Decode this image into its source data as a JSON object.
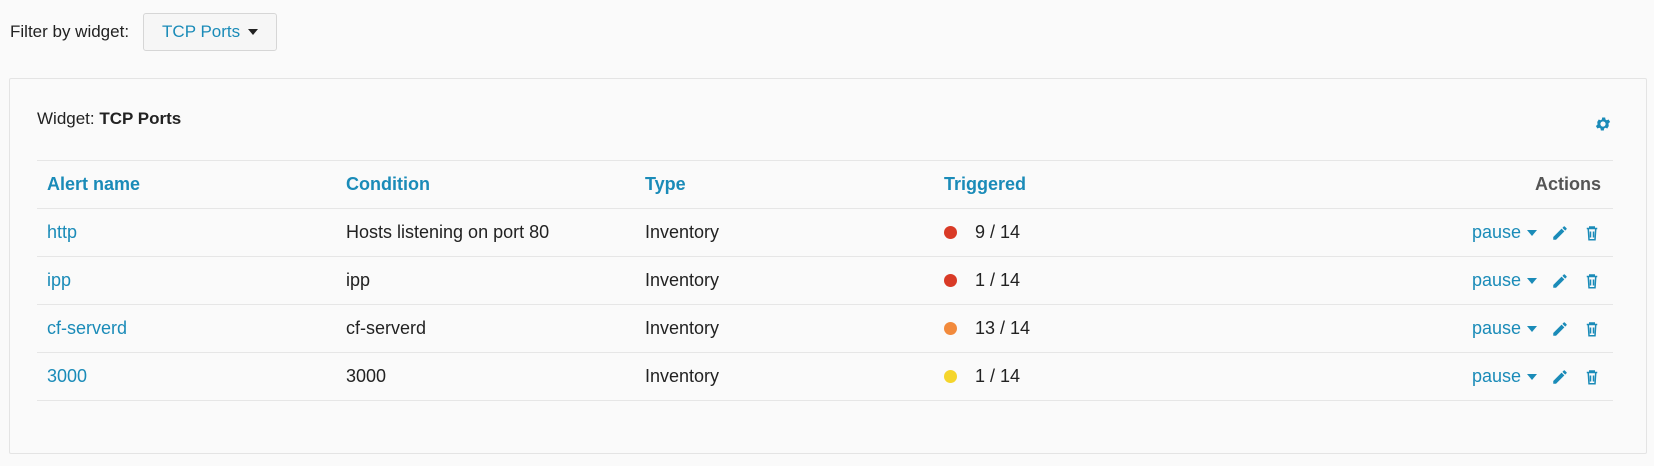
{
  "filter": {
    "label": "Filter by widget:",
    "selected": "TCP Ports"
  },
  "widget": {
    "prefix": "Widget:",
    "name": "TCP Ports"
  },
  "table": {
    "headers": {
      "name": "Alert name",
      "condition": "Condition",
      "type": "Type",
      "triggered": "Triggered",
      "actions": "Actions"
    },
    "rows": [
      {
        "name": "http",
        "condition": "Hosts listening on port 80",
        "type": "Inventory",
        "triggered": "9 / 14",
        "severity_color": "#d93a26",
        "action": "pause"
      },
      {
        "name": "ipp",
        "condition": "ipp",
        "type": "Inventory",
        "triggered": "1 / 14",
        "severity_color": "#d93a26",
        "action": "pause"
      },
      {
        "name": "cf-serverd",
        "condition": "cf-serverd",
        "type": "Inventory",
        "triggered": "13 / 14",
        "severity_color": "#f28a3c",
        "action": "pause"
      },
      {
        "name": "3000",
        "condition": "3000",
        "type": "Inventory",
        "triggered": "1 / 14",
        "severity_color": "#f5d52c",
        "action": "pause"
      }
    ]
  },
  "colors": {
    "accent": "#1a8bb8",
    "text": "#222222",
    "background": "#fafafa"
  },
  "icons": {
    "settings": "gear-icon",
    "edit": "pencil-icon",
    "delete": "trash-icon",
    "dropdown": "chevron-down-icon"
  }
}
